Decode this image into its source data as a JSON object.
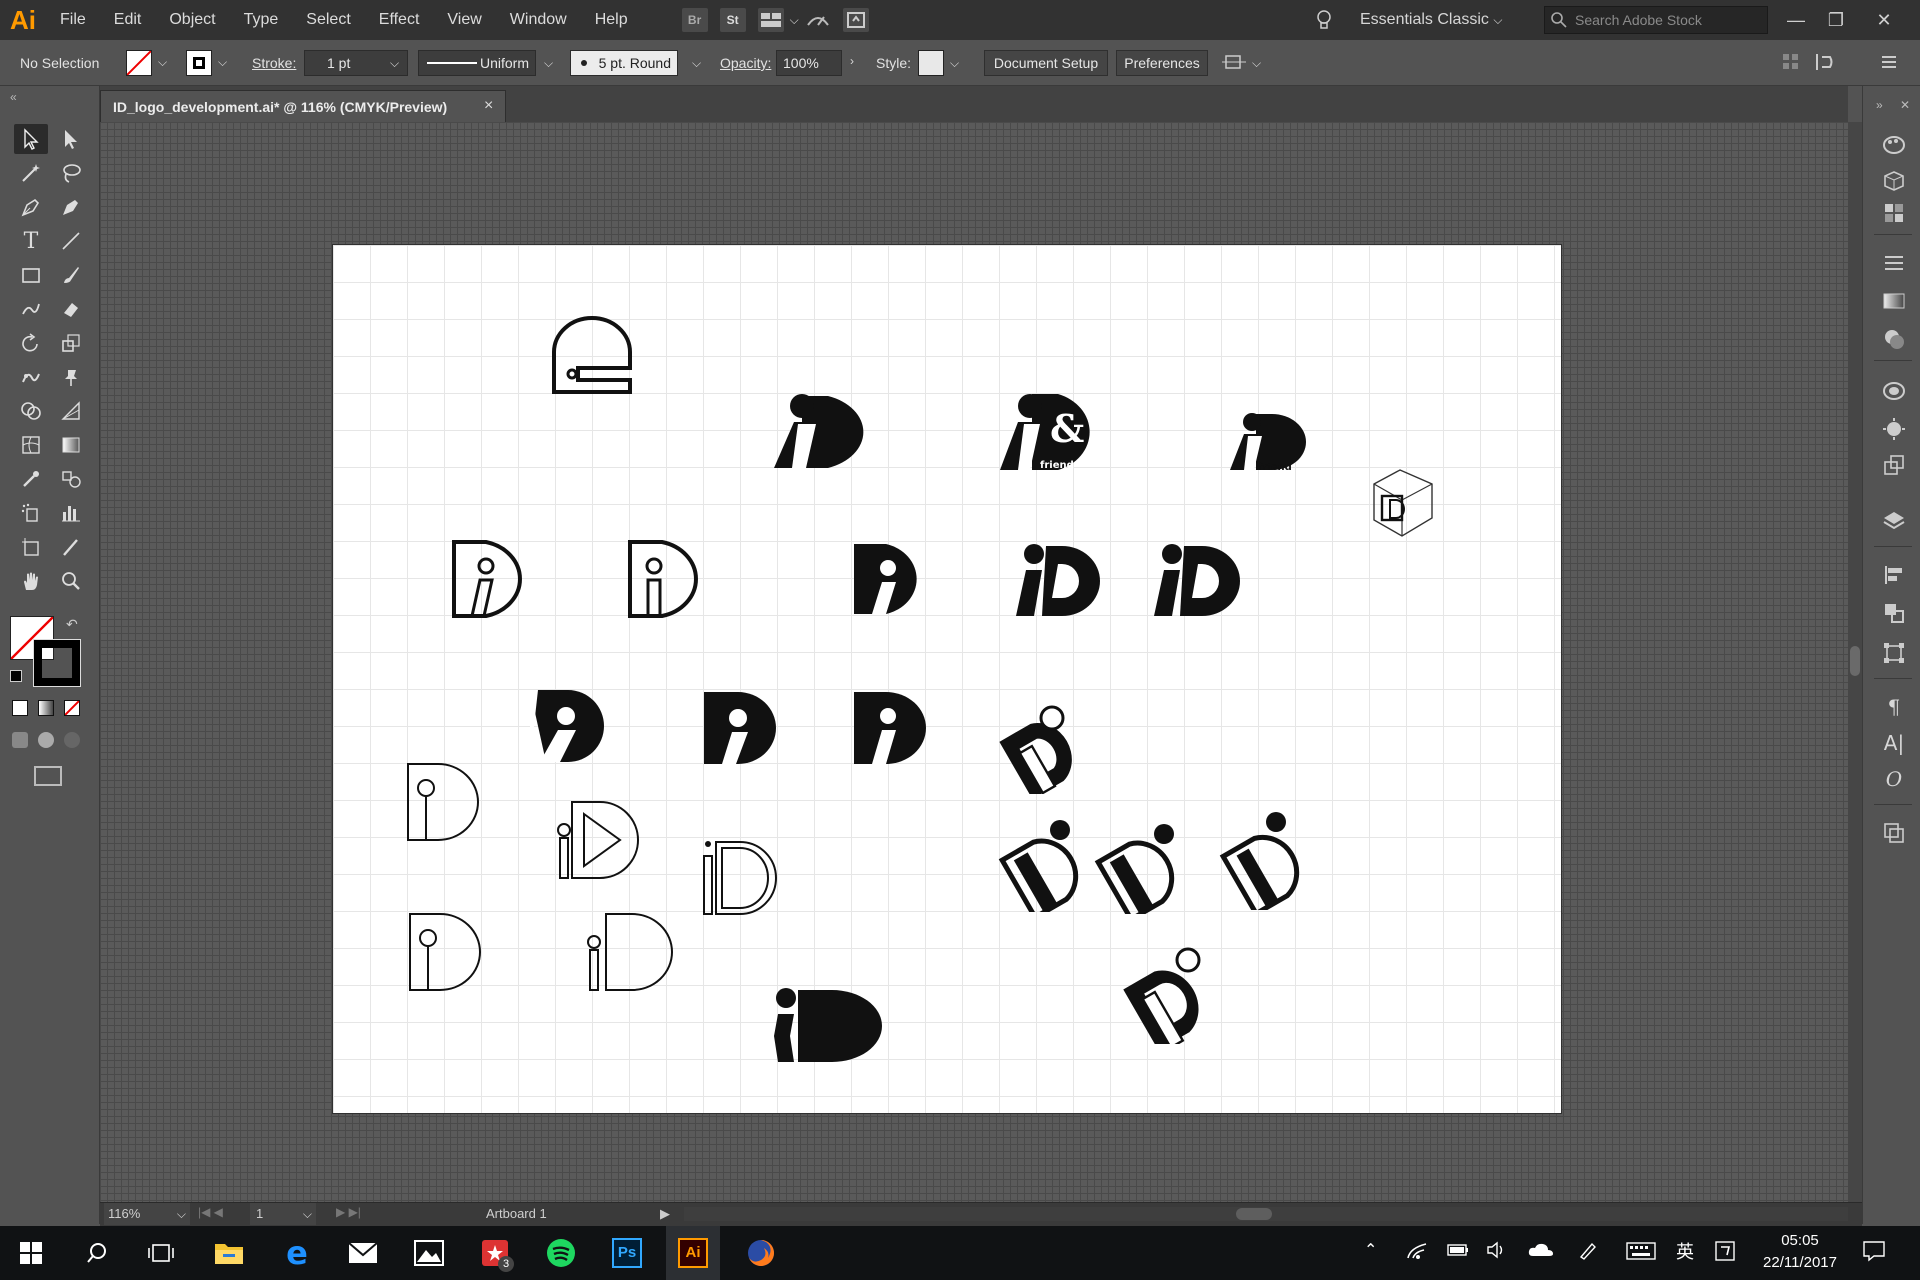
{
  "menubar": {
    "app_logo": "Ai",
    "items": [
      "File",
      "Edit",
      "Object",
      "Type",
      "Select",
      "Effect",
      "View",
      "Window",
      "Help"
    ],
    "bridge_label": "Br",
    "stock_label": "St",
    "workspace": "Essentials Classic",
    "search_placeholder": "Search Adobe Stock"
  },
  "controlbar": {
    "selection": "No Selection",
    "stroke_label": "Stroke:",
    "stroke_value": "1 pt",
    "profile": "Uniform",
    "brush": "5 pt. Round",
    "opacity_label": "Opacity:",
    "opacity_value": "100%",
    "style_label": "Style:",
    "document_setup": "Document Setup",
    "preferences": "Preferences"
  },
  "document": {
    "tab_title": "ID_logo_development.ai* @ 116% (CMYK/Preview)",
    "close": "×"
  },
  "statusbar": {
    "zoom": "116%",
    "artboard_number": "1",
    "artboard_name": "Artboard 1"
  },
  "taskbar": {
    "time": "05:05",
    "date": "22/11/2017",
    "ime": "英",
    "photoshop_label": "Ps",
    "illustrator_label": "Ai",
    "notification_badge": "3"
  },
  "logo_texts": {
    "ampersand": "&",
    "friend": "friend"
  },
  "colors": {
    "accent_ai": "#ff9a00",
    "ps_blue": "#31a8ff",
    "spotify_green": "#1ed760"
  }
}
